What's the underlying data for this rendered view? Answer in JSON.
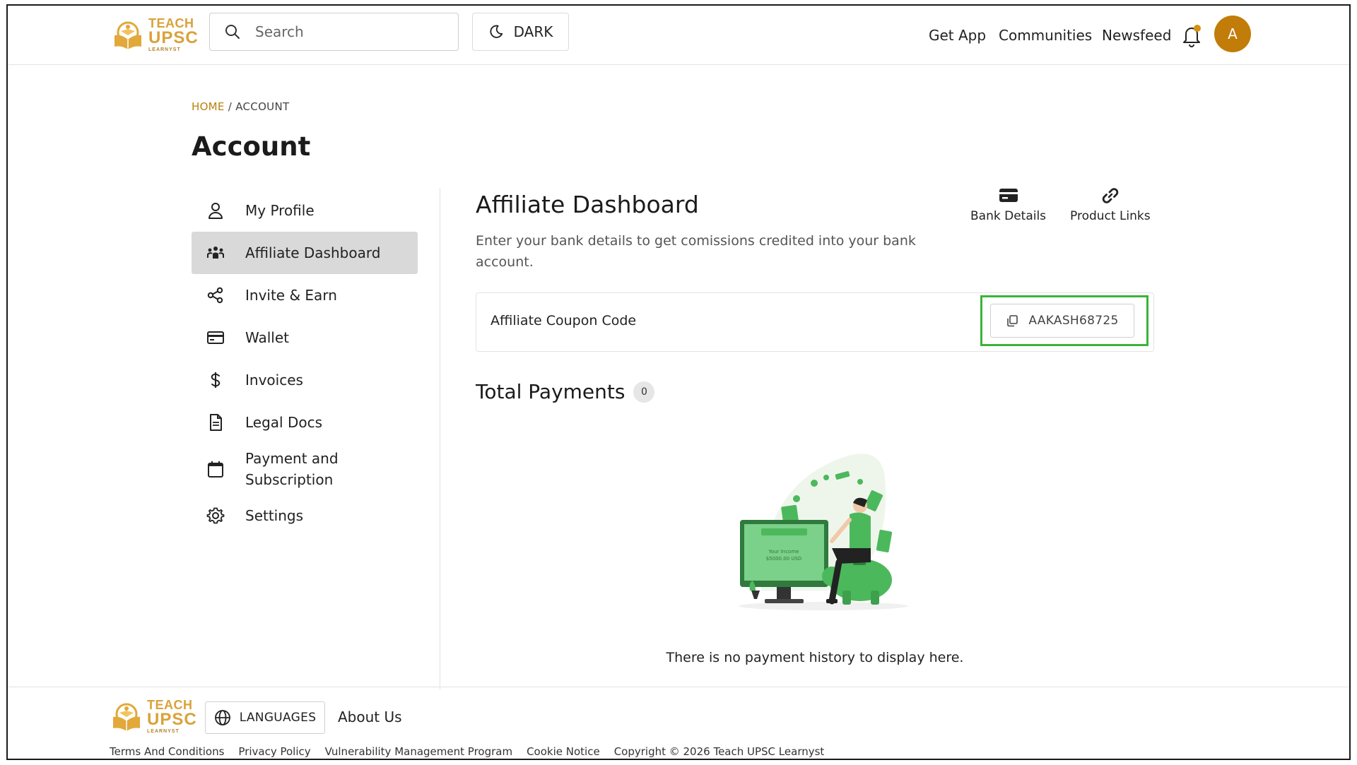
{
  "brand": {
    "line1": "TEACH",
    "line2": "UPSC",
    "line3": "LEARNYST"
  },
  "header": {
    "search_placeholder": "Search",
    "theme_label": "DARK",
    "nav": [
      "Get App",
      "Communities",
      "Newsfeed"
    ],
    "avatar_initial": "A"
  },
  "breadcrumb": {
    "home": "HOME",
    "sep": " / ",
    "current": "ACCOUNT"
  },
  "page_title": "Account",
  "sidebar": {
    "items": [
      {
        "label": "My Profile",
        "icon": "user-icon"
      },
      {
        "label": "Affiliate Dashboard",
        "icon": "group-icon",
        "active": true
      },
      {
        "label": "Invite & Earn",
        "icon": "share-icon"
      },
      {
        "label": "Wallet",
        "icon": "credit-card-icon"
      },
      {
        "label": "Invoices",
        "icon": "dollar-icon"
      },
      {
        "label": "Legal Docs",
        "icon": "document-icon"
      },
      {
        "label": "Payment and Subscription",
        "icon": "calendar-icon"
      },
      {
        "label": "Settings",
        "icon": "gear-icon"
      }
    ]
  },
  "main": {
    "title": "Affiliate Dashboard",
    "description": "Enter your bank details to get comissions credited into your bank account.",
    "tools": {
      "bank_details": "Bank Details",
      "product_links": "Product Links"
    },
    "coupon": {
      "label": "Affiliate Coupon Code",
      "code": "AAKASH68725"
    },
    "payments": {
      "title": "Total Payments",
      "count": "0",
      "empty_message": "There is no payment history to display here."
    },
    "illustration": {
      "screen_line1": "Your Income",
      "screen_line2": "$5000.00 USD"
    }
  },
  "footer": {
    "languages_label": "LANGUAGES",
    "about_label": "About Us",
    "links": [
      "Terms And Conditions",
      "Privacy Policy",
      "Vulnerability Management Program",
      "Cookie Notice",
      "Copyright © 2026 Teach UPSC Learnyst"
    ]
  },
  "colors": {
    "accent": "#c27c09",
    "highlight": "#3bb33b",
    "active_bg": "#d9d9d9",
    "illustration_green": "#4cb85c"
  }
}
